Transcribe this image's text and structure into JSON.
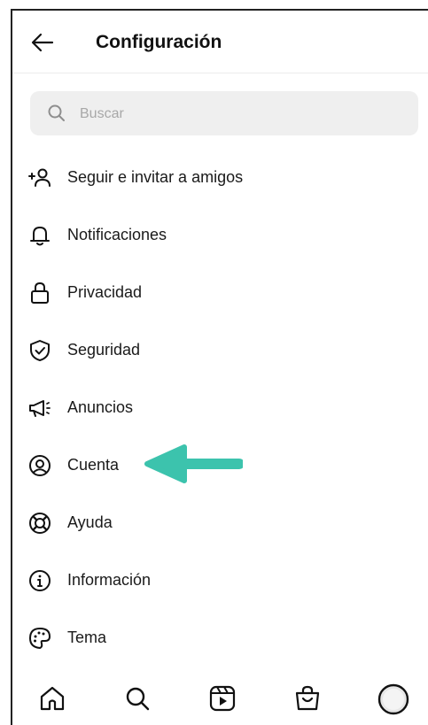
{
  "header": {
    "title": "Configuración",
    "back_icon": "arrow-left-icon"
  },
  "search": {
    "placeholder": "Buscar",
    "value": "",
    "icon": "search-icon"
  },
  "menu": {
    "items": [
      {
        "label": "Seguir e invitar a amigos",
        "icon": "add-person-icon"
      },
      {
        "label": "Notificaciones",
        "icon": "bell-icon"
      },
      {
        "label": "Privacidad",
        "icon": "lock-icon"
      },
      {
        "label": "Seguridad",
        "icon": "shield-check-icon"
      },
      {
        "label": "Anuncios",
        "icon": "megaphone-icon"
      },
      {
        "label": "Cuenta",
        "icon": "account-circle-icon"
      },
      {
        "label": "Ayuda",
        "icon": "lifebuoy-icon"
      },
      {
        "label": "Información",
        "icon": "info-icon"
      },
      {
        "label": "Tema",
        "icon": "palette-icon"
      }
    ]
  },
  "annotation": {
    "arrow_color": "#3cc3ad",
    "points_to": "Cuenta"
  },
  "bottom_nav": {
    "items": [
      "home-icon",
      "search-icon",
      "reels-icon",
      "shop-icon",
      "profile-avatar"
    ]
  },
  "colors": {
    "text": "#111111",
    "search_bg": "#efefef",
    "placeholder": "#a8a8a8",
    "accent_arrow": "#3cc3ad"
  }
}
